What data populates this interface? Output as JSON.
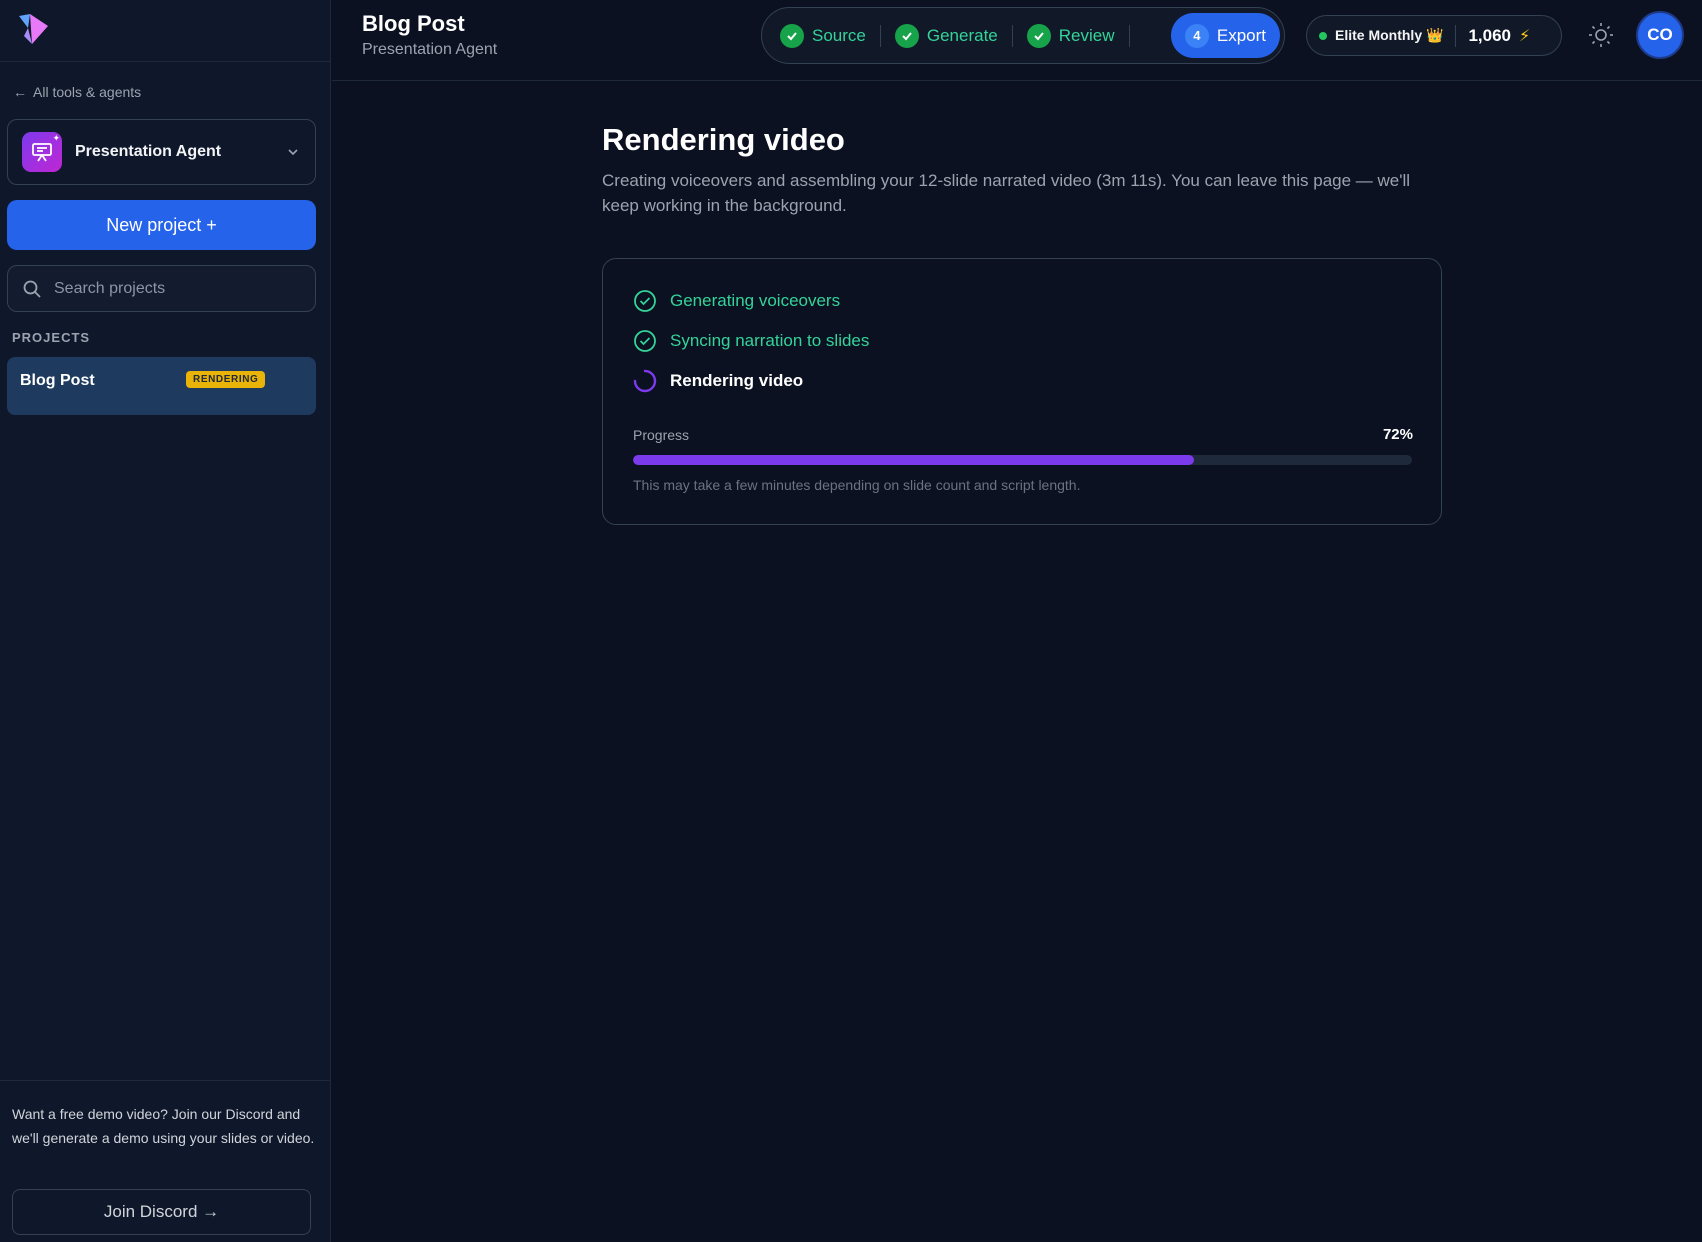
{
  "sidebar": {
    "back_link": "All tools & agents",
    "agent_select": "Presentation Agent",
    "new_project": "New project +",
    "search": {
      "placeholder": "Search projects"
    },
    "projects_label": "PROJECTS",
    "projects": [
      {
        "name": "Blog Post",
        "status": "RENDERING"
      }
    ],
    "promo": "Want a free demo video? Join our Discord and we'll generate a demo using your slides or video.",
    "discord_button": "Join Discord →"
  },
  "header": {
    "title": "Blog Post",
    "subtitle": "Presentation Agent",
    "steps": [
      {
        "label": "Source",
        "state": "done"
      },
      {
        "label": "Generate",
        "state": "done"
      },
      {
        "label": "Review",
        "state": "done"
      },
      {
        "number": "4",
        "label": "Export",
        "state": "active"
      }
    ],
    "plan": "Elite Monthly 👑",
    "credits": "1,060",
    "avatar_initials": "CO"
  },
  "main": {
    "title": "Rendering video",
    "description": "Creating voiceovers and assembling your 12-slide narrated video (3m 11s). You can leave this page — we'll keep working in the background.",
    "tasks": [
      {
        "label": "Generating voiceovers",
        "state": "done"
      },
      {
        "label": "Syncing narration to slides",
        "state": "done"
      },
      {
        "label": "Rendering video",
        "state": "in-progress"
      }
    ],
    "progress_label": "Progress",
    "progress_percent": 72,
    "progress_text": "72%",
    "progress_note": "This may take a few minutes depending on slide count and script length."
  },
  "colors": {
    "accent": "#2563eb",
    "success": "#34d399",
    "progress": "#7c3aed",
    "badge": "#eab308"
  }
}
